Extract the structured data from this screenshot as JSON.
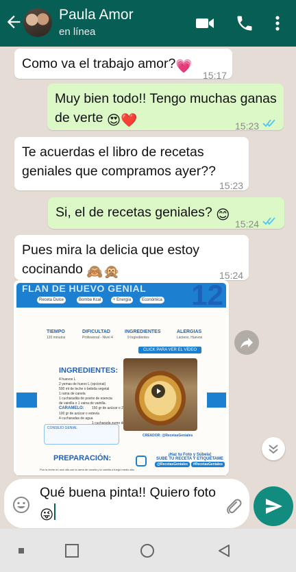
{
  "header": {
    "contact_name": "Paula Amor",
    "status": "en línea",
    "icons": [
      "back-arrow-icon",
      "video-call-icon",
      "phone-icon",
      "more-vertical-icon"
    ],
    "color": "#075e54"
  },
  "messages": [
    {
      "direction": "in",
      "text": "Como va el trabajo amor?",
      "emoji": "💗",
      "time": "15:17"
    },
    {
      "direction": "out",
      "line1": "Muy bien todo!! Tengo muchas ganas",
      "line2": "de verte",
      "emoji": "😍❤️",
      "time": "15:23",
      "read": true
    },
    {
      "direction": "in",
      "line1": "Te acuerdas el libro de recetas",
      "line2": "geniales que compramos ayer??",
      "time": "15:23"
    },
    {
      "direction": "out",
      "text": "Si, el de recetas geniales?",
      "emoji": "😊",
      "time": "15:24",
      "read": true
    },
    {
      "direction": "in",
      "line1": "Pues mira la delicia que estoy",
      "line2": "cocinando",
      "emoji": "🙈🙊",
      "time": "15:24"
    }
  ],
  "image_message": {
    "recipe_title": "FLAN DE HUEVO GENIAL",
    "recipe_number": "12",
    "pills": [
      "Receta Dulce",
      "Bomba Kcal",
      "+ Energía",
      "Económica"
    ],
    "stats": [
      {
        "label": "TIEMPO",
        "sub": "120 minutos"
      },
      {
        "label": "DIFICULTAD",
        "sub": "Profesional - Nivel 4"
      },
      {
        "label": "INGREDIENTES",
        "sub": "9 Ingredientes"
      },
      {
        "label": "ALERGIAS",
        "sub": "Lácteos, Huevos"
      }
    ],
    "video_label": "CLICK PARA VER EL VÍDEO",
    "ingredients_title": "INGREDIENTES:",
    "ingredients": [
      "4 huevos L",
      "2 yemas de huevo L (opcional)",
      "500 ml de leche o bebida vegetal",
      "1 rama de canela",
      "1 cucharadita de postre de esencia",
      "de vainilla o 1 vaina de vainilla.",
      "150 gr de azúcar o 2 cdas estevia"
    ],
    "caramelo_title": "CARAMELO:",
    "caramelo": [
      "100 gr de azúcar o estevia",
      "4 cucharadas de agua",
      "1 cucharada zumo de limón"
    ],
    "consejo_title": "CONSEJO GENIAL",
    "creador": "CREADOR: @RecetasGeniales",
    "preparacion_title": "PREPARACIÓN:",
    "foto_title": "¡Haz tu Foto y Súbela!",
    "foto_sub": "SUBE TU RECETA Y ETIQUÉTAME",
    "tags": [
      "@RecetasGeniales",
      "#RecetasGeniales"
    ],
    "step1": "Pon la leche en una olla con la rama de canela y la vainilla a fuego medio alto."
  },
  "composer": {
    "text": "Qué buena pinta!! Quiero foto",
    "emoji": "😜"
  },
  "nav": [
    "recents",
    "home",
    "back"
  ]
}
